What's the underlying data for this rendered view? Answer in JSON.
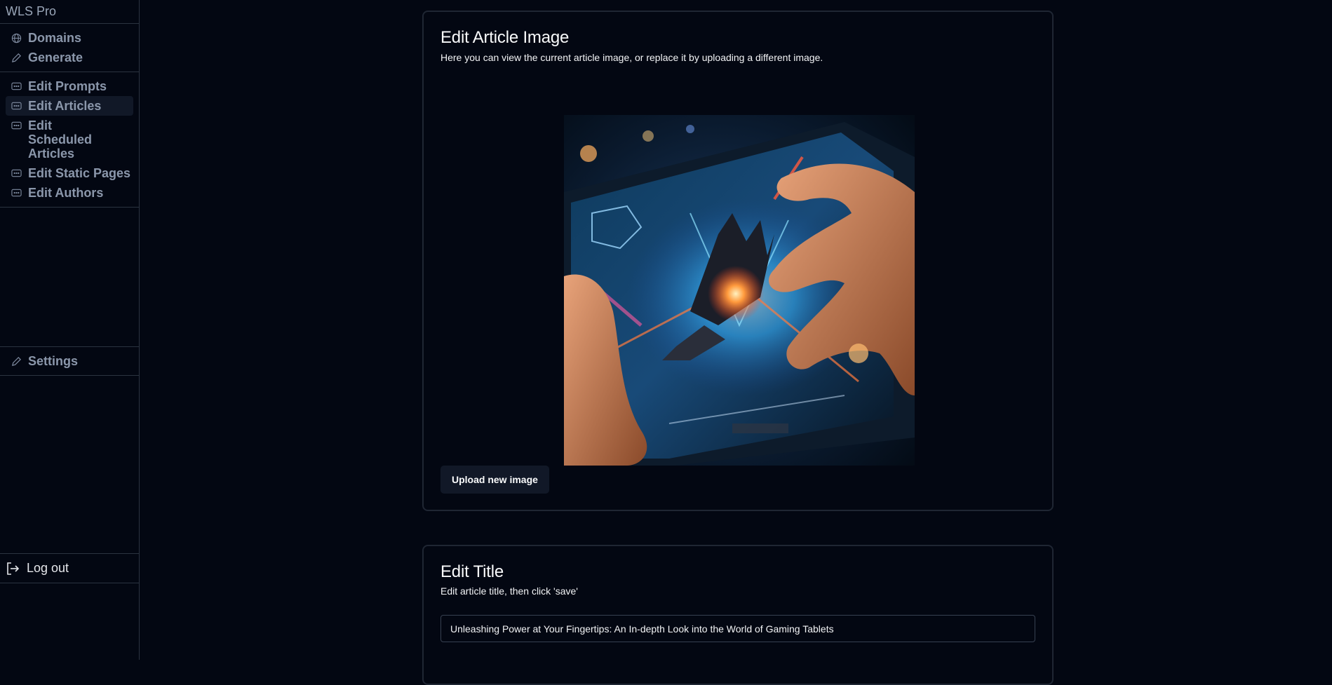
{
  "app": {
    "title": "WLS Pro"
  },
  "sidebar": {
    "primary": [
      {
        "label": "Domains",
        "icon": "globe-icon"
      },
      {
        "label": "Generate",
        "icon": "pencil-icon"
      }
    ],
    "edit": [
      {
        "label": "Edit Prompts",
        "icon": "ellipsis-box-icon"
      },
      {
        "label": "Edit Articles",
        "icon": "ellipsis-box-icon",
        "active": true
      },
      {
        "label": "Edit Scheduled Articles",
        "icon": "ellipsis-box-icon"
      },
      {
        "label": "Edit Static Pages",
        "icon": "ellipsis-box-icon"
      },
      {
        "label": "Edit Authors",
        "icon": "ellipsis-box-icon"
      }
    ],
    "settings": {
      "label": "Settings",
      "icon": "pencil-icon"
    },
    "logout": {
      "label": "Log out",
      "icon": "logout-icon"
    }
  },
  "image_card": {
    "title": "Edit Article Image",
    "description": "Here you can view the current article image, or replace it by uploading a different image.",
    "upload_label": "Upload new image"
  },
  "title_card": {
    "title": "Edit Title",
    "description": "Edit article title, then click 'save'",
    "value": "Unleashing Power at Your Fingertips: An In-depth Look into the World of Gaming Tablets"
  },
  "colors": {
    "background": "#030712",
    "border": "#2b3340",
    "active": "#111827"
  }
}
